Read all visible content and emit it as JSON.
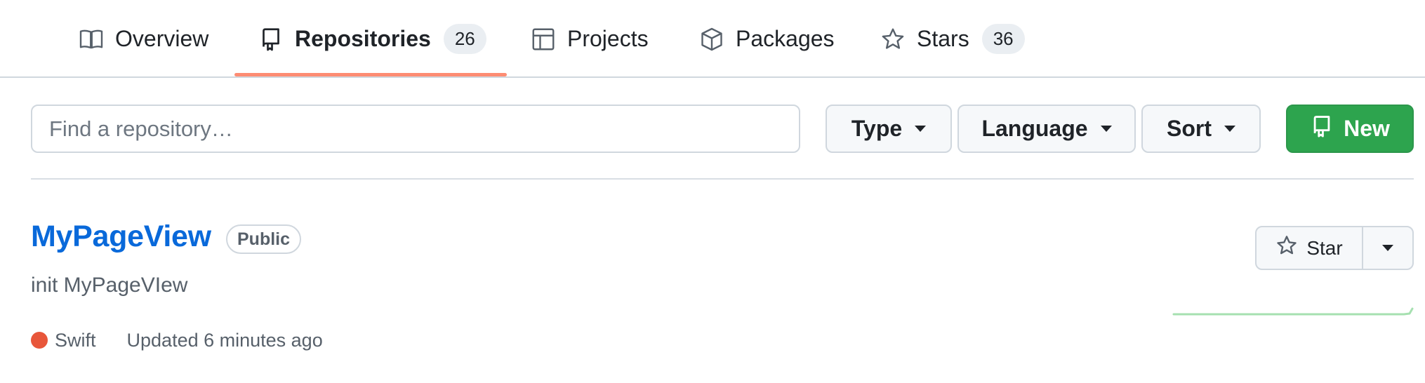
{
  "tabs": [
    {
      "label": "Overview",
      "icon": "book-icon"
    },
    {
      "label": "Repositories",
      "icon": "repo-icon",
      "count": "26",
      "active": true
    },
    {
      "label": "Projects",
      "icon": "table-icon"
    },
    {
      "label": "Packages",
      "icon": "package-icon"
    },
    {
      "label": "Stars",
      "icon": "star-icon",
      "count": "36"
    }
  ],
  "filters": {
    "search_placeholder": "Find a repository…",
    "type_label": "Type",
    "language_label": "Language",
    "sort_label": "Sort",
    "new_label": "New"
  },
  "repo": {
    "name": "MyPageView",
    "visibility": "Public",
    "description": "init MyPageVIew",
    "language": "Swift",
    "language_color": "#e8563a",
    "updated": "Updated 6 minutes ago",
    "star_label": "Star"
  },
  "colors": {
    "accent_underline": "#fd8c73",
    "link": "#0969da",
    "new_button": "#2da44e",
    "sparkline": "#a6e0b0"
  }
}
